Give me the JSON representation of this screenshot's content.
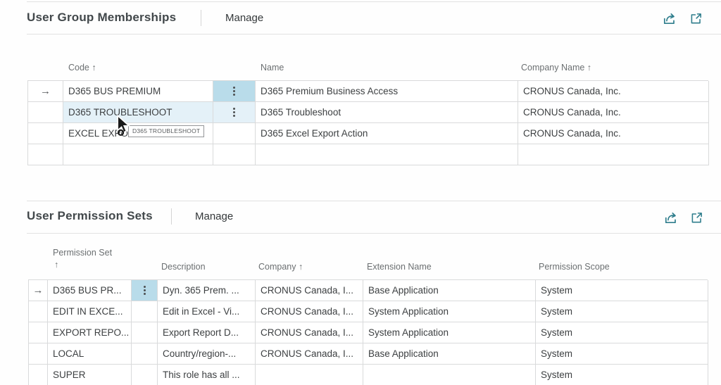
{
  "ui": {
    "section1": {
      "title": "User Group Memberships",
      "manage": "Manage",
      "col_code": "Code ↑",
      "col_name": "Name",
      "col_company": "Company Name ↑",
      "rows": [
        {
          "code": "D365 BUS PREMIUM",
          "name": "D365 Premium Business Access",
          "company": "CRONUS Canada, Inc."
        },
        {
          "code": "D365 TROUBLESHOOT",
          "name": "D365 Troubleshoot",
          "company": "CRONUS Canada, Inc."
        },
        {
          "code": "EXCEL EXPORT ACTION",
          "name": "D365 Excel Export Action",
          "company": "CRONUS Canada, Inc."
        },
        {
          "code": "",
          "name": "",
          "company": ""
        }
      ]
    },
    "tooltip": "D365 TROUBLESHOOT",
    "section2": {
      "title": "User Permission Sets",
      "manage": "Manage",
      "col_set_line1": "Permission Set",
      "col_set_line2": "↑",
      "col_desc": "Description",
      "col_company": "Company ↑",
      "col_ext": "Extension Name",
      "col_scope": "Permission Scope",
      "rows": [
        {
          "set": "D365 BUS PR...",
          "desc": "Dyn. 365 Prem. ...",
          "company": "CRONUS Canada, I...",
          "ext": "Base Application",
          "scope": "System"
        },
        {
          "set": "EDIT IN EXCE...",
          "desc": "Edit in Excel - Vi...",
          "company": "CRONUS Canada, I...",
          "ext": "System Application",
          "scope": "System"
        },
        {
          "set": "EXPORT REPO...",
          "desc": "Export Report D...",
          "company": "CRONUS Canada, I...",
          "ext": "System Application",
          "scope": "System"
        },
        {
          "set": "LOCAL",
          "desc": "Country/region-...",
          "company": "CRONUS Canada, I...",
          "ext": "Base Application",
          "scope": "System"
        },
        {
          "set": "SUPER",
          "desc": "This role has all ...",
          "company": "",
          "ext": "",
          "scope": "System"
        }
      ]
    },
    "icons": {
      "share": "share-icon",
      "popout": "open-in-new-window-icon",
      "row_menu": "ellipsis-icon",
      "current_row": "right-arrow-icon"
    },
    "colors": {
      "accent_teal": "#2e7d8c",
      "focused_cell_bg": "#b9dcea",
      "selected_row_bg": "#e4f1f8"
    }
  }
}
